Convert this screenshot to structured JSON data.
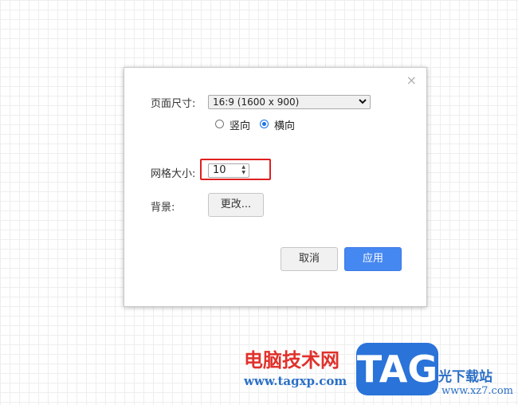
{
  "dialog": {
    "close_glyph": "×",
    "page_size_label": "页面尺寸:",
    "page_size_value": "16:9 (1600 x 900)",
    "orientation": {
      "options": [
        {
          "label": "竖向",
          "checked": false
        },
        {
          "label": "横向",
          "checked": true
        }
      ]
    },
    "grid_size_label": "网格大小:",
    "grid_size_value": "10",
    "background_label": "背景:",
    "change_button": "更改...",
    "cancel_button": "取消",
    "apply_button": "应用"
  },
  "watermark": {
    "brand_cn": "电脑技术网",
    "url": "www.tagxp.com",
    "logo_text": "TAG",
    "brand_cn2": "光下载站",
    "url2": "www.xz7.com"
  },
  "colors": {
    "accent": "#4688f1",
    "highlight": "#e02020"
  },
  "icons": {
    "close": "close-icon",
    "dropdown": "chevron-down-icon",
    "spinner": "spinner-arrows-icon"
  }
}
